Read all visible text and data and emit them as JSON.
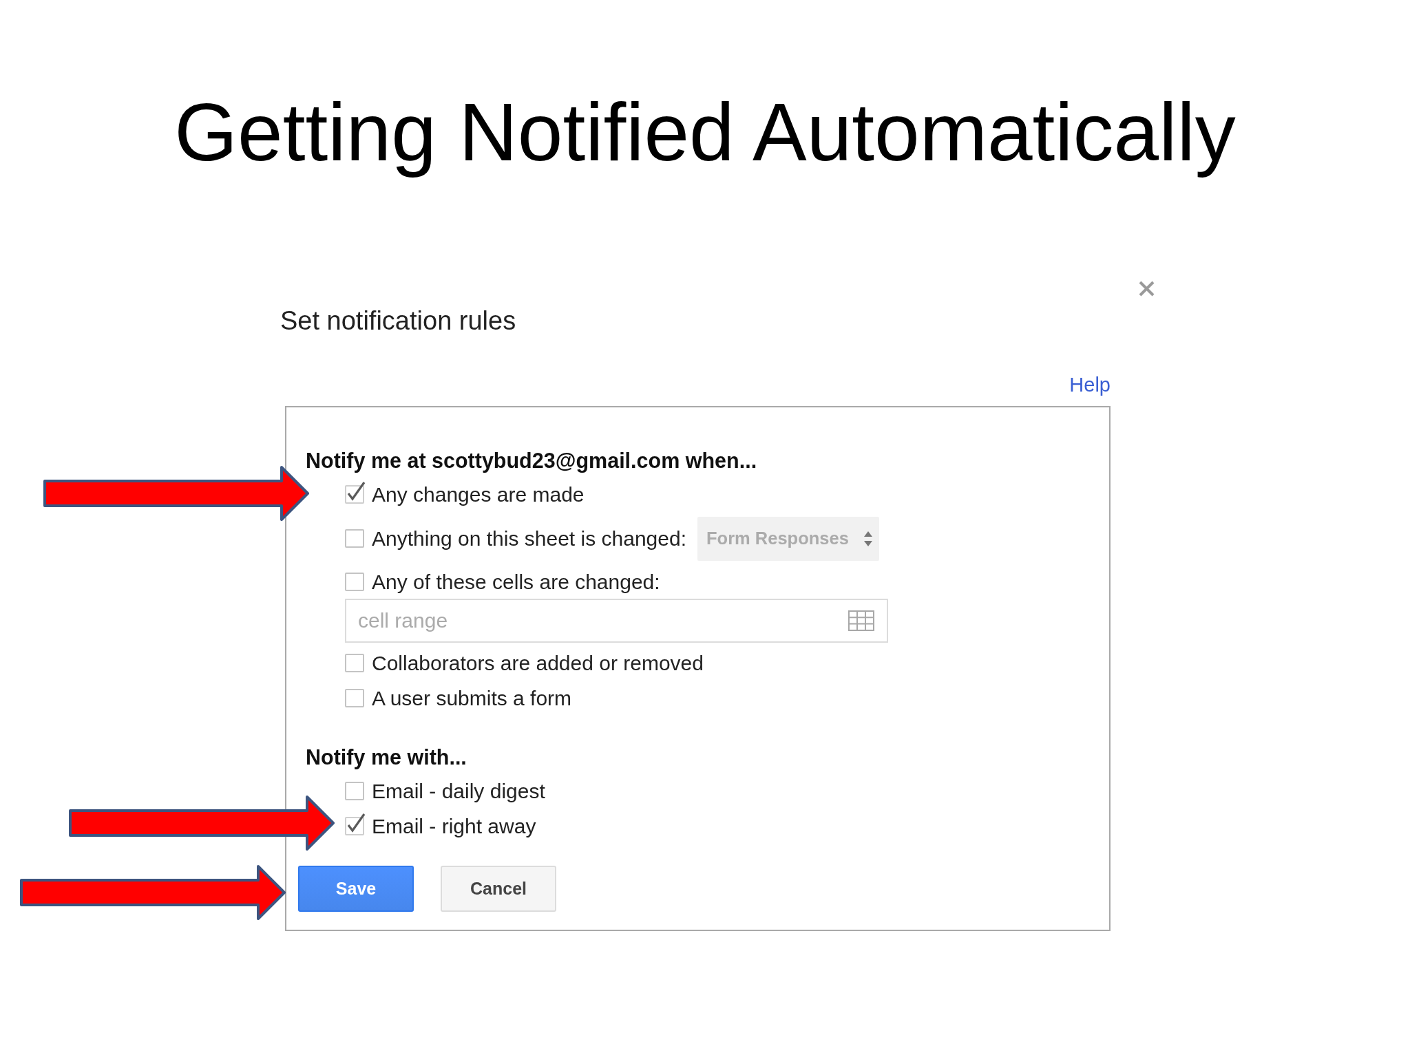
{
  "slide": {
    "title": "Getting Notified Automatically"
  },
  "dialog": {
    "title": "Set notification rules",
    "help_link": "Help",
    "sections": [
      {
        "heading": "Notify me at scottybud23@gmail.com when...",
        "options": [
          {
            "kind": "plain",
            "label": "Any changes are made",
            "checked": true
          },
          {
            "kind": "sheet",
            "label": "Anything on this sheet is changed:",
            "checked": false,
            "sheet": {
              "value": "Form Responses",
              "disabled": true
            }
          },
          {
            "kind": "range",
            "label": "Any of these cells are changed:",
            "checked": false,
            "range": {
              "placeholder": "cell range"
            }
          },
          {
            "kind": "plain",
            "label": "Collaborators are added or removed",
            "checked": false
          },
          {
            "kind": "plain",
            "label": "A user submits a form",
            "checked": false
          }
        ]
      },
      {
        "heading": "Notify me with...",
        "options": [
          {
            "kind": "plain",
            "label": "Email - daily digest",
            "checked": false
          },
          {
            "kind": "plain",
            "label": "Email - right away",
            "checked": true
          }
        ]
      }
    ],
    "buttons": [
      {
        "label": "Save",
        "kind": "primary"
      },
      {
        "label": "Cancel",
        "kind": "secondary"
      }
    ]
  }
}
